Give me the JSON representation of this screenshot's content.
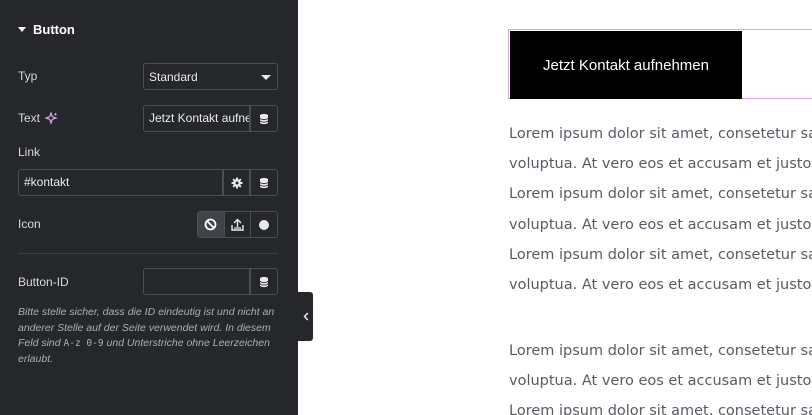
{
  "panel": {
    "section_title": "Button",
    "type_label": "Typ",
    "type_value": "Standard",
    "text_label": "Text",
    "text_value": "Jetzt Kontakt aufnehmen",
    "link_label": "Link",
    "link_value": "#kontakt",
    "icon_label": "Icon",
    "button_id_label": "Button-ID",
    "button_id_value": "",
    "help_part1": "Bitte stelle sicher, dass die ID eindeutig ist und nicht an anderer Stelle auf der Seite verwendet wird. In diesem Feld sind ",
    "help_code": "A-z 0-9",
    "help_part2": " und Unterstriche ohne Leerzeichen erlaubt."
  },
  "canvas": {
    "button_text": "Jetzt Kontakt aufnehmen",
    "paragraph1": [
      "Lorem ipsum dolor sit amet, consetetur sadipscing",
      "voluptua. At vero eos et accusam et justo duo",
      "Lorem ipsum dolor sit amet, consetetur sadipscing",
      "voluptua. At vero eos et accusam et justo duo",
      "Lorem ipsum dolor sit amet, consetetur sadipscing",
      "voluptua. At vero eos et accusam et justo duo"
    ],
    "paragraph2": [
      "Lorem ipsum dolor sit amet, consetetur sadipscing",
      "voluptua. At vero eos et accusam et justo duo",
      "Lorem ipsum dolor sit amet, consetetur sadipscing"
    ]
  },
  "icons": {
    "section_caret": "caret-down-icon",
    "ai": "sparkle-icon",
    "dynamic": "database-icon",
    "settings": "gear-icon",
    "none": "ban-icon",
    "upload": "upload-icon",
    "library": "circle-icon",
    "collapse": "chevron-left-icon"
  },
  "colors": {
    "panel_bg": "#26272b",
    "accent_ai": "#e4a7e9",
    "cta_bg": "#000000",
    "selection_border": "#e4a7e9"
  }
}
